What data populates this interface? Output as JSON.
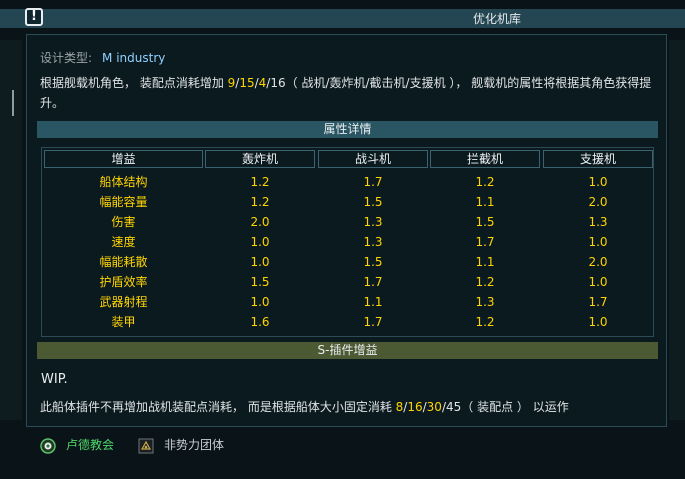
{
  "header": {
    "title": "优化机库",
    "warning_icon_text": "!"
  },
  "design": {
    "label": "设计类型:",
    "value": "M industry"
  },
  "description": {
    "part1": "根据舰载机角色， 装配点消耗增加 ",
    "v1": "9",
    "s1": "/",
    "v2": "15",
    "s2": "/",
    "v3": "4",
    "s3": "/",
    "v4": "16",
    "part2": "（ 战机/轰炸机/截击机/支援机 ）， 舰载机的属性将根据其角色获得提升。"
  },
  "attr_section": {
    "title": "属性详情"
  },
  "table": {
    "headers": [
      "增益",
      "轰炸机",
      "战斗机",
      "拦截机",
      "支援机"
    ],
    "rows": [
      [
        "船体结构",
        "1.2",
        "1.7",
        "1.2",
        "1.0"
      ],
      [
        "幅能容量",
        "1.2",
        "1.5",
        "1.1",
        "2.0"
      ],
      [
        "伤害",
        "2.0",
        "1.3",
        "1.5",
        "1.3"
      ],
      [
        "速度",
        "1.0",
        "1.3",
        "1.7",
        "1.0"
      ],
      [
        "幅能耗散",
        "1.0",
        "1.5",
        "1.1",
        "2.0"
      ],
      [
        "护盾效率",
        "1.5",
        "1.7",
        "1.2",
        "1.0"
      ],
      [
        "武器射程",
        "1.0",
        "1.1",
        "1.3",
        "1.7"
      ],
      [
        "装甲",
        "1.6",
        "1.7",
        "1.2",
        "1.0"
      ]
    ]
  },
  "plugin_section": {
    "title": "S-插件增益",
    "wip": "WIP.",
    "part1": "此船体插件不再增加战机装配点消耗， 而是根据船体大小固定消耗 ",
    "v1": "8",
    "s1": "/",
    "v2": "16",
    "s2": "/",
    "v3": "30",
    "s3": "/",
    "v4": "45",
    "part2": "（ 装配点 ） 以运作"
  },
  "factions": [
    {
      "label": "卢德教会",
      "icon": "luddic-church-icon",
      "color": "#4fd66a"
    },
    {
      "label": "非势力团体",
      "icon": "independent-icon",
      "color": "#c8ccce"
    }
  ],
  "colors": {
    "highlight": "#ffd400",
    "header_bar": "#244552",
    "attr_bar": "#2a5663",
    "plugin_bar": "#4b5a33",
    "design_value": "#8fd0ff"
  }
}
